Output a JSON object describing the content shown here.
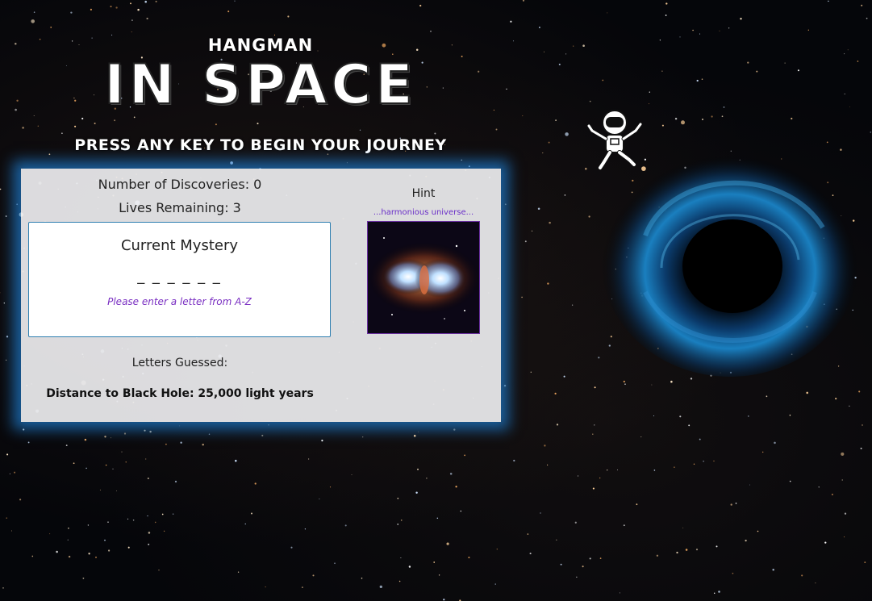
{
  "header": {
    "small_title": "HANGMAN",
    "big_title": "IN SPACE",
    "instruction": "PRESS ANY KEY TO BEGIN YOUR JOURNEY"
  },
  "game": {
    "discoveries": "Number of Discoveries: 0",
    "lives": "Lives Remaining: 3",
    "mystery_title": "Current Mystery",
    "mystery_word": "_ _ _ _ _ _",
    "mystery_prompt": "Please enter a letter from A-Z",
    "letters_guessed": "Letters Guessed:",
    "distance": "Distance to Black Hole: 25,000 light years"
  },
  "hint": {
    "label": "Hint",
    "text": "...harmonious universe..."
  },
  "colors": {
    "panel_glow": "#1e78c8",
    "prompt_purple": "#7a2fc2",
    "hint_purple": "#6a2fc8",
    "mystery_border": "#2f7fb0"
  },
  "icons": {
    "astronaut": "astronaut-icon",
    "black_hole": "black-hole-icon",
    "hint_image": "nebula-image"
  }
}
